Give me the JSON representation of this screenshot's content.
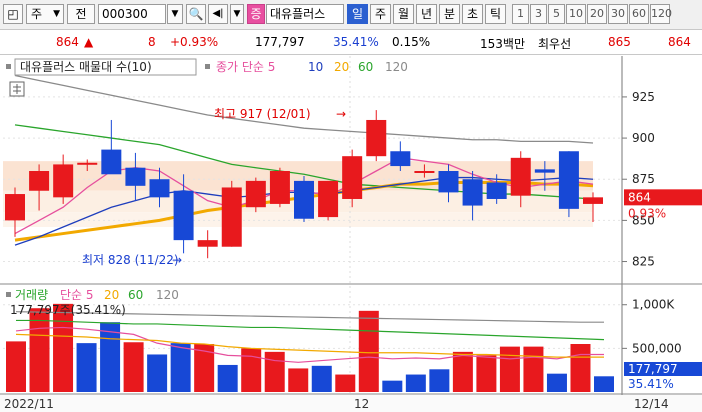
{
  "toolbar": {
    "type_select": "주",
    "prev_label": "전",
    "code_value": "000300",
    "tag_label": "증",
    "stock_name": "대유플러스",
    "periods": [
      "일",
      "주",
      "월",
      "년",
      "분",
      "초",
      "틱"
    ],
    "selected_period": "일",
    "intervals": [
      "1",
      "3",
      "5",
      "10",
      "20",
      "30",
      "60",
      "120"
    ]
  },
  "infobar": {
    "price": "864",
    "arrow": "▲",
    "change": "8",
    "change_pct": "+0.93%",
    "volume": "177,797",
    "volume_ratio": "35.41%",
    "turnover": "0.15%",
    "amount": "153백만",
    "best_label": "최우선",
    "ask": "865",
    "bid": "864"
  },
  "chart_data": [
    {
      "type": "candlestick",
      "title": "대유플러스 매물대 수(10)",
      "legend": [
        "종가 단순 5",
        "10",
        "20",
        "60",
        "120"
      ],
      "colors": {
        "up": "#e8191d",
        "down": "#1748d6",
        "ma5": "#e64f9d",
        "ma10": "#1e3ebd",
        "ma20": "#f2a900",
        "ma60": "#2aa52c",
        "ma120": "#8a8a8a"
      },
      "ylim": [
        815,
        945
      ],
      "yticks": [
        825,
        850,
        875,
        900,
        925
      ],
      "candles": [
        {
          "o": 850,
          "h": 870,
          "l": 840,
          "c": 866
        },
        {
          "o": 868,
          "h": 884,
          "l": 856,
          "c": 880
        },
        {
          "o": 864,
          "h": 890,
          "l": 860,
          "c": 884
        },
        {
          "o": 885,
          "h": 887,
          "l": 880,
          "c": 885
        },
        {
          "o": 893,
          "h": 911,
          "l": 880,
          "c": 878
        },
        {
          "o": 882,
          "h": 891,
          "l": 862,
          "c": 871
        },
        {
          "o": 875,
          "h": 882,
          "l": 858,
          "c": 864
        },
        {
          "o": 868,
          "h": 878,
          "l": 830,
          "c": 838
        },
        {
          "o": 834,
          "h": 844,
          "l": 827,
          "c": 838
        },
        {
          "o": 834,
          "h": 874,
          "l": 834,
          "c": 870
        },
        {
          "o": 858,
          "h": 876,
          "l": 855,
          "c": 874
        },
        {
          "o": 860,
          "h": 882,
          "l": 858,
          "c": 880
        },
        {
          "o": 874,
          "h": 877,
          "l": 849,
          "c": 851
        },
        {
          "o": 852,
          "h": 874,
          "l": 850,
          "c": 874
        },
        {
          "o": 863,
          "h": 893,
          "l": 858,
          "c": 889
        },
        {
          "o": 889,
          "h": 917,
          "l": 886,
          "c": 911
        },
        {
          "o": 892,
          "h": 898,
          "l": 880,
          "c": 883
        },
        {
          "o": 880,
          "h": 884,
          "l": 876,
          "c": 880
        },
        {
          "o": 880,
          "h": 884,
          "l": 861,
          "c": 867
        },
        {
          "o": 875,
          "h": 880,
          "l": 850,
          "c": 859
        },
        {
          "o": 873,
          "h": 878,
          "l": 860,
          "c": 863
        },
        {
          "o": 865,
          "h": 892,
          "l": 858,
          "c": 888
        },
        {
          "o": 881,
          "h": 886,
          "l": 868,
          "c": 879
        },
        {
          "o": 892,
          "h": 892,
          "l": 852,
          "c": 857
        },
        {
          "o": 860,
          "h": 867,
          "l": 849,
          "c": 864
        }
      ],
      "ma": {
        "ma5": [
          842,
          850,
          858,
          870,
          880,
          882,
          880,
          871,
          862,
          858,
          862,
          868,
          868,
          865,
          872,
          880,
          888,
          886,
          884,
          878,
          873,
          870,
          872,
          874,
          872
        ],
        "ma10": [
          835,
          840,
          846,
          852,
          858,
          862,
          866,
          868,
          866,
          864,
          865,
          867,
          867,
          866,
          868,
          870,
          872,
          874,
          876,
          876,
          875,
          874,
          875,
          876,
          875
        ],
        "ma20": [
          838,
          840,
          842,
          844,
          846,
          848,
          850,
          853,
          856,
          858,
          860,
          862,
          864,
          866,
          868,
          870,
          872,
          872,
          873,
          873,
          873,
          873,
          872,
          872,
          871
        ],
        "ma60": [
          908,
          906,
          904,
          902,
          900,
          898,
          896,
          892,
          888,
          884,
          882,
          880,
          878,
          875,
          872,
          871,
          870,
          869,
          868,
          867,
          866,
          866,
          865,
          864,
          863
        ],
        "ma120": [
          938,
          935,
          932,
          929,
          926,
          923,
          920,
          917,
          914,
          912,
          910,
          908,
          906,
          905,
          904,
          903,
          902,
          901,
          900,
          899,
          899,
          898,
          898,
          898,
          897
        ]
      },
      "annotations": [
        {
          "text": "최고 917 (12/01)",
          "color": "#e00000"
        },
        {
          "text": "최저 828 (11/22)",
          "color": "#1a3fd0"
        }
      ],
      "price_tag": {
        "value": "864",
        "pct": "0.93%"
      }
    },
    {
      "type": "bar",
      "title": "거래량",
      "legend": [
        "단순 5",
        "20",
        "60",
        "120"
      ],
      "yticks_labels": [
        "500,000",
        "1,000K"
      ],
      "ylim": [
        0,
        1100000
      ],
      "values": [
        580000,
        960000,
        1010000,
        560000,
        800000,
        570000,
        430000,
        560000,
        550000,
        310000,
        500000,
        460000,
        270000,
        300000,
        200000,
        930000,
        130000,
        200000,
        260000,
        460000,
        420000,
        520000,
        520000,
        210000,
        550000,
        180000
      ],
      "up": [
        true,
        true,
        true,
        false,
        false,
        true,
        false,
        false,
        true,
        false,
        true,
        true,
        true,
        false,
        true,
        true,
        false,
        false,
        false,
        true,
        true,
        true,
        true,
        false,
        true,
        false
      ],
      "ma_lines": {
        "ma5": [
          700000,
          730000,
          740000,
          720000,
          690000,
          660000,
          560000,
          510000,
          470000,
          420000,
          410000,
          360000,
          340000,
          360000,
          380000,
          400000,
          380000,
          390000,
          380000,
          420000,
          400000,
          380000,
          400000,
          380000,
          430000,
          430000
        ],
        "ma20": [
          660000,
          650000,
          640000,
          630000,
          610000,
          600000,
          590000,
          560000,
          550000,
          520000,
          500000,
          490000,
          480000,
          470000,
          460000,
          450000,
          450000,
          450000,
          440000,
          430000,
          430000,
          420000,
          410000,
          400000,
          400000,
          400000
        ],
        "ma60": [
          820000,
          820000,
          810000,
          800000,
          790000,
          780000,
          780000,
          770000,
          760000,
          750000,
          740000,
          740000,
          730000,
          720000,
          710000,
          700000,
          690000,
          680000,
          670000,
          660000,
          650000,
          640000,
          630000,
          620000,
          610000,
          600000
        ],
        "ma120": [
          920000,
          915000,
          910000,
          905000,
          900000,
          895000,
          890000,
          885000,
          880000,
          875000,
          870000,
          865000,
          860000,
          855000,
          850000,
          845000,
          840000,
          835000,
          830000,
          825000,
          820000,
          815000,
          810000,
          805000,
          800000,
          800000
        ]
      },
      "volume_label": "177,797주(35.41%)",
      "tag": {
        "value": "177,797",
        "pct": "35.41%"
      }
    }
  ],
  "xaxis": {
    "labels": [
      "2022/11",
      "12",
      "12/14"
    ]
  }
}
